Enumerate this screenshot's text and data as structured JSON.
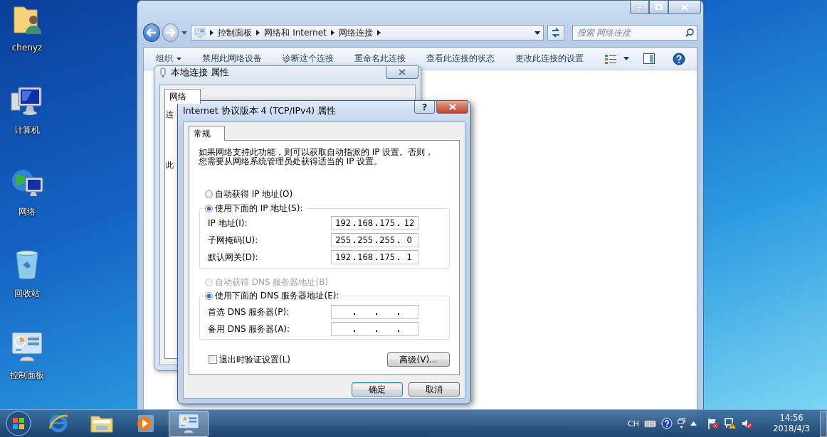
{
  "desktop_icons": [
    {
      "kind": "user-folder",
      "label": "chenyz"
    },
    {
      "kind": "computer",
      "label": "计算机"
    },
    {
      "kind": "network",
      "label": "网络"
    },
    {
      "kind": "recycle-bin",
      "label": "回收站"
    },
    {
      "kind": "control-panel",
      "label": "控制面板"
    }
  ],
  "explorer": {
    "breadcrumb": [
      "控制面板",
      "网络和 Internet",
      "网络连接"
    ],
    "search": {
      "placeholder": "搜索 网络连接"
    },
    "toolbar": [
      {
        "label": "组织",
        "dropdown": true
      },
      {
        "label": "禁用此网络设备",
        "dropdown": false
      },
      {
        "label": "诊断这个连接",
        "dropdown": false
      },
      {
        "label": "重命名此连接",
        "dropdown": false
      },
      {
        "label": "查看此连接的状态",
        "dropdown": false
      },
      {
        "label": "更改此连接的设置",
        "dropdown": false
      }
    ]
  },
  "properties_dialog": {
    "title": "本地连接 属性",
    "tabs": [
      {
        "label": "网络",
        "selected": true
      }
    ],
    "labels": [
      "连",
      "此"
    ]
  },
  "ipv4_dialog": {
    "title": "Internet 协议版本 4 (TCP/IPv4) 属性",
    "help": "?",
    "tabs": [
      {
        "label": "常规",
        "selected": true
      }
    ],
    "intro": [
      "如果网络支持此功能，则可以获取自动指派的 IP 设置。否则，",
      "您需要从网络系统管理员处获得适当的 IP 设置。"
    ],
    "ip_options": [
      {
        "label": "自动获得 IP 地址(O)",
        "selected": false,
        "disabled": false
      },
      {
        "label": "使用下面的 IP 地址(S):",
        "selected": true,
        "disabled": false
      }
    ],
    "ip_fields": [
      {
        "label": "IP 地址(I):",
        "octets": [
          "192",
          "168",
          "175",
          "12"
        ]
      },
      {
        "label": "子网掩码(U):",
        "octets": [
          "255",
          "255",
          "255",
          "0"
        ]
      },
      {
        "label": "默认网关(D):",
        "octets": [
          "192",
          "168",
          "175",
          "1"
        ]
      }
    ],
    "dns_options": [
      {
        "label": "自动获得 DNS 服务器地址(B)",
        "selected": false,
        "disabled": true
      },
      {
        "label": "使用下面的 DNS 服务器地址(E):",
        "selected": true,
        "disabled": false
      }
    ],
    "dns_fields": [
      {
        "label": "首选 DNS 服务器(P):"
      },
      {
        "label": "备用 DNS 服务器(A):"
      }
    ],
    "validate": {
      "label": "退出时验证设置(L)",
      "checked": false
    },
    "advanced": "高级(V)...",
    "buttons": [
      {
        "label": "确定",
        "default": true
      },
      {
        "label": "取消",
        "default": false
      }
    ]
  },
  "taskbar": {
    "apps": [
      {
        "kind": "browser",
        "active": false
      },
      {
        "kind": "folder",
        "active": false
      },
      {
        "kind": "media-player",
        "active": false
      },
      {
        "kind": "control-panel",
        "active": true
      }
    ],
    "language": "CH",
    "clock": {
      "time": "14:56",
      "date": "2018/4/3"
    }
  }
}
